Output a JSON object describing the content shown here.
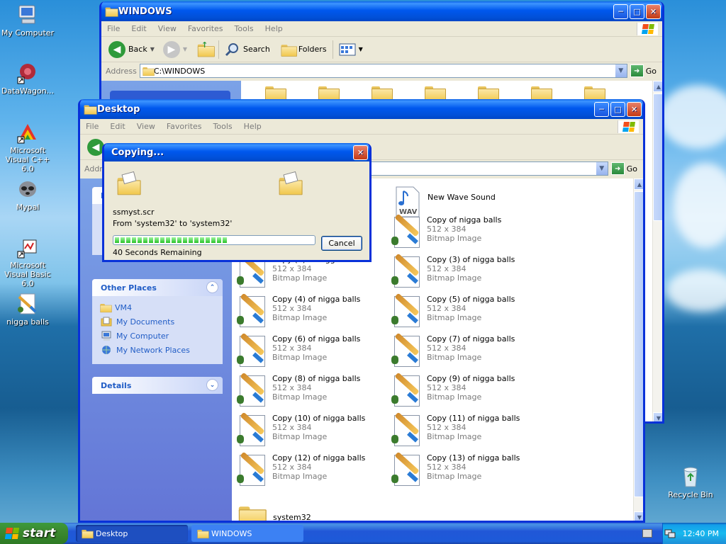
{
  "desktop": {
    "icons": [
      {
        "label": "My Computer"
      },
      {
        "label": "DataWagon..."
      },
      {
        "label": "Microsoft Visual C++ 6.0"
      },
      {
        "label": "Mypal"
      },
      {
        "label": "Microsoft Visual Basic 6.0"
      },
      {
        "label": "nigga balls"
      },
      {
        "label": "Recycle Bin"
      }
    ]
  },
  "windows_window": {
    "title": "WINDOWS",
    "menu": [
      "File",
      "Edit",
      "View",
      "Favorites",
      "Tools",
      "Help"
    ],
    "toolbar": {
      "back": "Back",
      "search": "Search",
      "folders": "Folders"
    },
    "address_label": "Address",
    "address_value": "C:\\WINDOWS",
    "go": "Go"
  },
  "desktop_window": {
    "title": "Desktop",
    "menu": [
      "File",
      "Edit",
      "View",
      "Favorites",
      "Tools",
      "Help"
    ],
    "address_label": "Addre",
    "go": "Go",
    "other_places": {
      "header": "Other Places",
      "links": [
        "VM4",
        "My Documents",
        "My Computer",
        "My Network Places"
      ]
    },
    "details_header": "Details",
    "file_tasks_header_partial": "F",
    "files": [
      {
        "name": "New Wave Sound",
        "line2": "",
        "line3": "",
        "icon": "wav-icon"
      },
      {
        "name": "Copy of nigga balls",
        "line2": "512 x 384",
        "line3": "Bitmap Image"
      },
      {
        "name": "Copy (2) of nigga balls",
        "line2": "512 x 384",
        "line3": "Bitmap Image"
      },
      {
        "name": "Copy (3) of nigga balls",
        "line2": "512 x 384",
        "line3": "Bitmap Image"
      },
      {
        "name": "Copy (4) of nigga balls",
        "line2": "512 x 384",
        "line3": "Bitmap Image"
      },
      {
        "name": "Copy (5) of nigga balls",
        "line2": "512 x 384",
        "line3": "Bitmap Image"
      },
      {
        "name": "Copy (6) of nigga balls",
        "line2": "512 x 384",
        "line3": "Bitmap Image"
      },
      {
        "name": "Copy (7) of nigga balls",
        "line2": "512 x 384",
        "line3": "Bitmap Image"
      },
      {
        "name": "Copy (8) of nigga balls",
        "line2": "512 x 384",
        "line3": "Bitmap Image"
      },
      {
        "name": "Copy (9) of nigga balls",
        "line2": "512 x 384",
        "line3": "Bitmap Image"
      },
      {
        "name": "Copy (10) of nigga balls",
        "line2": "512 x 384",
        "line3": "Bitmap Image"
      },
      {
        "name": "Copy (11) of nigga balls",
        "line2": "512 x 384",
        "line3": "Bitmap Image"
      },
      {
        "name": "Copy (12) of nigga balls",
        "line2": "512 x 384",
        "line3": "Bitmap Image"
      },
      {
        "name": "Copy (13) of nigga balls",
        "line2": "512 x 384",
        "line3": "Bitmap Image"
      },
      {
        "name": "system32",
        "line2": "",
        "line3": "",
        "icon": "folder-icon"
      }
    ]
  },
  "copy_dialog": {
    "title": "Copying...",
    "filename": "ssmyst.scr",
    "from_to": "From 'system32' to 'system32'",
    "remaining": "40 Seconds Remaining",
    "cancel": "Cancel",
    "progress_fraction": 0.58
  },
  "taskbar": {
    "start": "start",
    "tasks": [
      "Desktop",
      "WINDOWS"
    ],
    "clock": "12:40 PM"
  }
}
